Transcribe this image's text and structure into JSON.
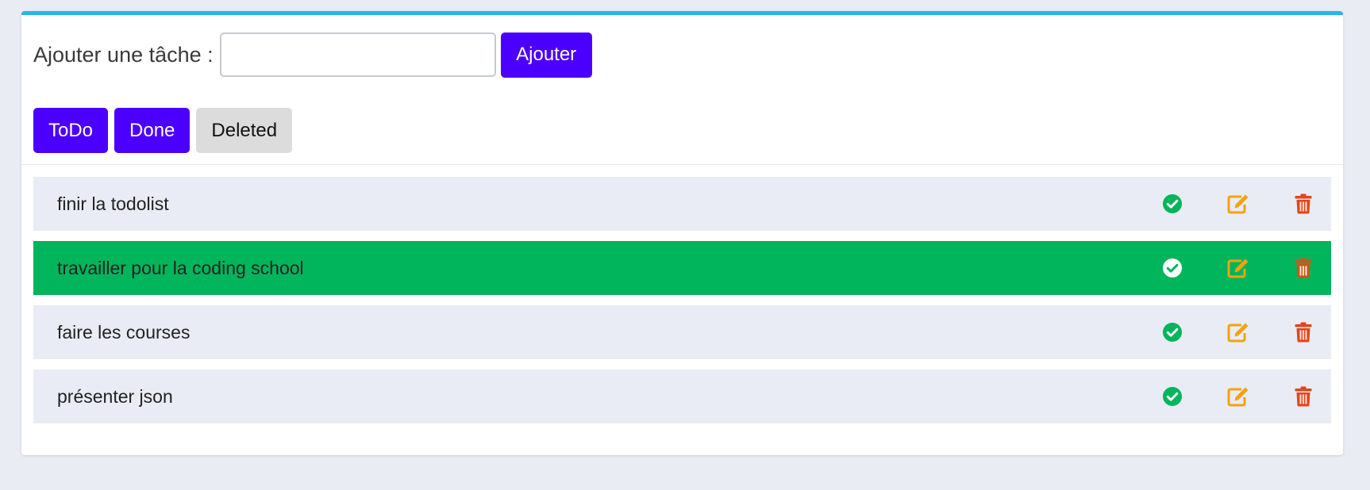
{
  "add_form": {
    "label": "Ajouter une tâche :",
    "input_value": "",
    "input_placeholder": "",
    "button_label": "Ajouter"
  },
  "filters": [
    {
      "label": "ToDo",
      "active": true
    },
    {
      "label": "Done",
      "active": true
    },
    {
      "label": "Deleted",
      "active": false
    }
  ],
  "tasks": [
    {
      "text": "finir la todolist",
      "done": false
    },
    {
      "text": "travailler pour la coding school",
      "done": true
    },
    {
      "text": "faire les courses",
      "done": false
    },
    {
      "text": "présenter json",
      "done": false
    }
  ],
  "icons": {
    "check": "check-circle-icon",
    "edit": "edit-icon",
    "delete": "trash-icon"
  },
  "colors": {
    "accent": "#4b00ff",
    "top_border": "#2bb3e6",
    "done_row": "#00b55b",
    "check_icon": "#00b55b",
    "edit_icon": "#f2a30f",
    "trash_icon": "#e0461a",
    "row_bg": "#e9ecf4"
  }
}
